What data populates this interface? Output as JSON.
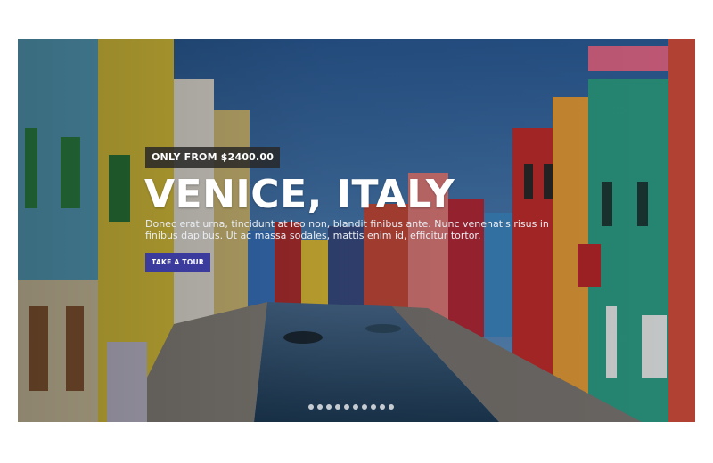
{
  "hero": {
    "badge": "ONLY FROM $2400.00",
    "title": "VENICE, ITALY",
    "description": "Donec erat urna, tincidunt at leo non, blandit finibus ante. Nunc venenatis risus in finibus dapibus. Ut ac massa sodales, mattis enim id, efficitur tortor.",
    "cta_label": "TAKE A TOUR",
    "cta_color": "#3b3b9e"
  },
  "pagination": {
    "count": 10
  },
  "photo": {
    "icon": "canal-photo-background"
  }
}
